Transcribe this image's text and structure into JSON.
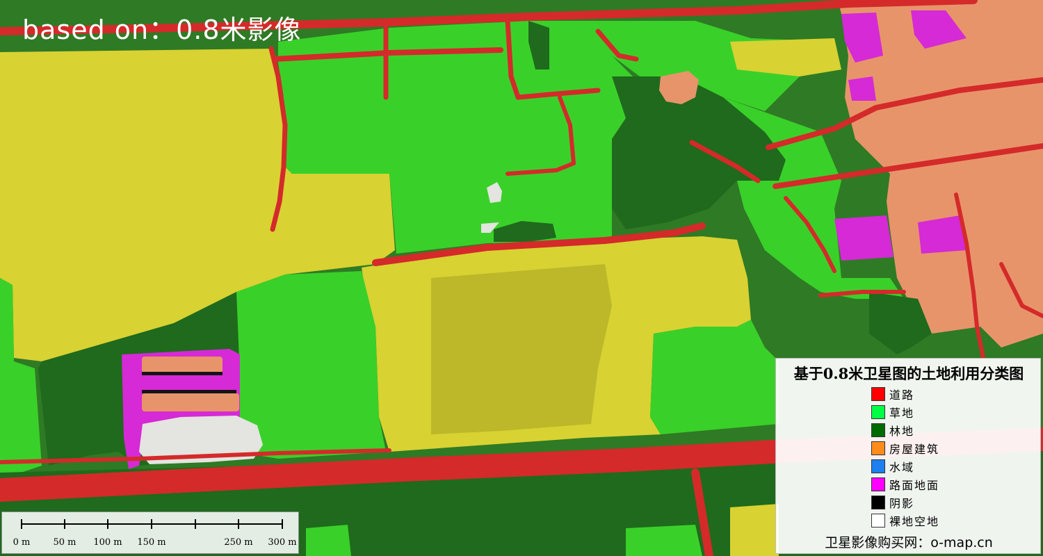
{
  "map": {
    "overlay_title": "based on：0.8米影像",
    "colors": {
      "road": "#d42a2a",
      "grass": "#3ad02a",
      "forest": "#1f6a1c",
      "building": "#e8946a",
      "water": "#1e7ff0",
      "paved_ground": "#d52ad5",
      "shadow": "#000000",
      "bare_land": "#ffffff",
      "cropland": "#d8d232"
    }
  },
  "legend": {
    "title": "基于0.8米卫星图的土地利用分类图",
    "items": [
      {
        "label": "道路",
        "color": "#ff0000"
      },
      {
        "label": "草地",
        "color": "#00ff44"
      },
      {
        "label": "林地",
        "color": "#006b00"
      },
      {
        "label": "房屋建筑",
        "color": "#ff8c1a"
      },
      {
        "label": "水域",
        "color": "#1e7ff0"
      },
      {
        "label": "路面地面",
        "color": "#ff00ff"
      },
      {
        "label": "阴影",
        "color": "#000000"
      },
      {
        "label": "裸地空地",
        "color": "#ffffff"
      }
    ],
    "source": "卫星影像购买网：o-map.cn"
  },
  "scalebar": {
    "ticks": [
      {
        "label": "0 m"
      },
      {
        "label": "50 m"
      },
      {
        "label": "100 m"
      },
      {
        "label": "150 m"
      },
      {
        "label": ""
      },
      {
        "label": "250 m"
      },
      {
        "label": "300 m"
      }
    ]
  }
}
